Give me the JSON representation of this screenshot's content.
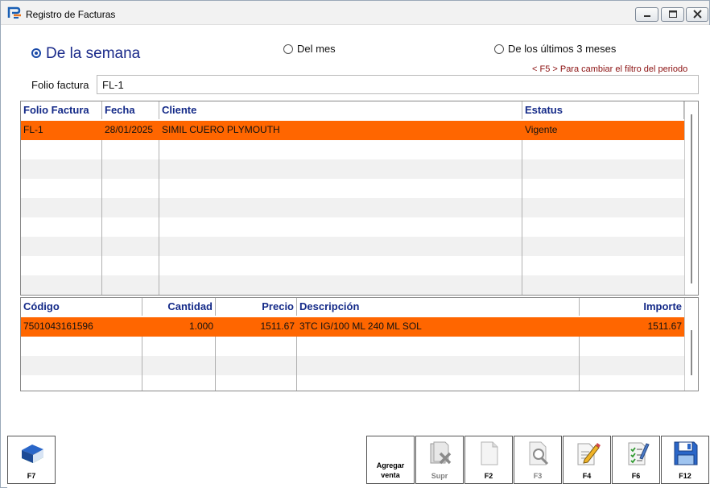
{
  "window": {
    "title": "Registro de Facturas"
  },
  "filters": {
    "semana": "De la semana",
    "mes": "Del mes",
    "tres_meses": "De los últimos 3 meses",
    "hint": "< F5 > Para cambiar el filtro del periodo"
  },
  "folio": {
    "label": "Folio factura",
    "value": "FL-1"
  },
  "invoices": {
    "headers": [
      "Folio Factura",
      "Fecha",
      "Cliente",
      "Estatus"
    ],
    "rows": [
      [
        "FL-1",
        "28/01/2025",
        "SIMIL CUERO PLYMOUTH",
        "Vigente"
      ]
    ]
  },
  "details": {
    "headers": [
      "Código",
      "Cantidad",
      "Precio",
      "Descripción",
      "Importe"
    ],
    "rows": [
      [
        "7501043161596",
        "1.000",
        "1511.67",
        "3TC IG/100 ML 240 ML SOL",
        "1511.67"
      ]
    ]
  },
  "colors": {
    "selected_row": "#ff6600",
    "header_text": "#142a88"
  },
  "buttons": {
    "f7": "F7",
    "agregar_1": "Agregar",
    "agregar_2": "venta",
    "supr": "Supr",
    "f2": "F2",
    "f3": "F3",
    "f4": "F4",
    "f6": "F6",
    "f12": "F12"
  }
}
